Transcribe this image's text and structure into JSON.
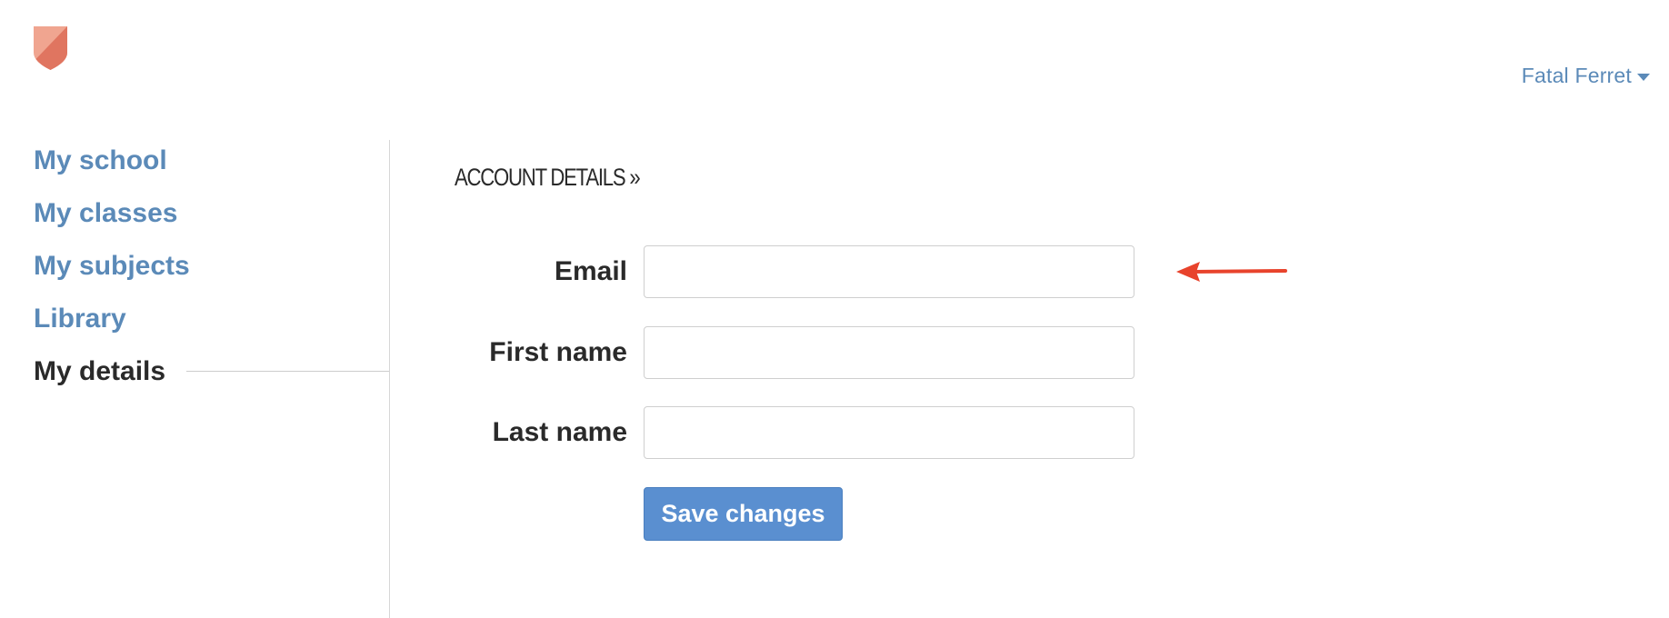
{
  "header": {
    "logo_icon": "shield-icon",
    "user_name": "Fatal Ferret",
    "user_menu_icon": "caret-down-icon"
  },
  "sidebar": {
    "items": [
      {
        "label": "My school",
        "active": false
      },
      {
        "label": "My classes",
        "active": false
      },
      {
        "label": "My subjects",
        "active": false
      },
      {
        "label": "Library",
        "active": false
      },
      {
        "label": "My details",
        "active": true
      }
    ]
  },
  "main": {
    "section_title": "ACCOUNT DETAILS »",
    "form": {
      "email_label": "Email",
      "email_value": "",
      "first_name_label": "First name",
      "first_name_value": "",
      "last_name_label": "Last name",
      "last_name_value": "",
      "save_label": "Save changes"
    }
  },
  "annotation": {
    "arrow_icon": "arrow-left-icon",
    "arrow_color": "#e8432c"
  },
  "colors": {
    "link": "#5b8ab8",
    "primary_button": "#5a8fd0",
    "text": "#2a2a2a",
    "logo_light": "#f0a590",
    "logo_dark": "#e07560"
  }
}
